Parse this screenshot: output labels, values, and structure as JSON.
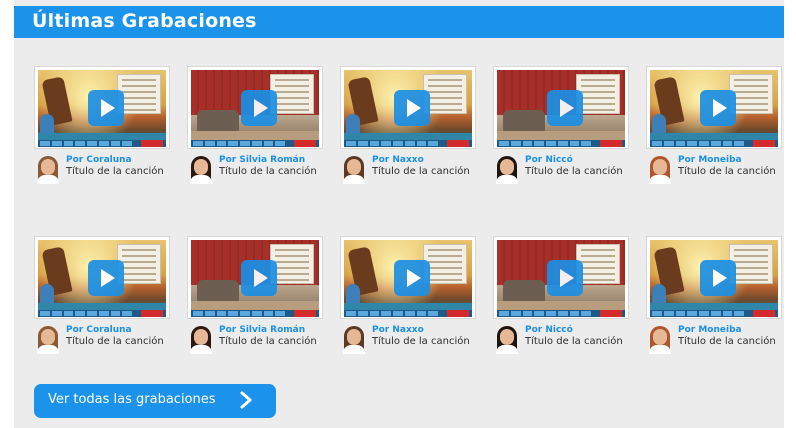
{
  "header": {
    "title": "Últimas Grabaciones"
  },
  "recordings": [
    {
      "author": "Por Coraluna",
      "song": "Título de la canción",
      "scene": "beach",
      "hair": "#8a5a34"
    },
    {
      "author": "Por Silvia Román",
      "song": "Título de la canción",
      "scene": "room",
      "hair": "#2a1a12"
    },
    {
      "author": "Por Naxxo",
      "song": "Título de la canción",
      "scene": "beach",
      "hair": "#5a3a22"
    },
    {
      "author": "Por Niccó",
      "song": "Título de la canción",
      "scene": "room",
      "hair": "#1d1410"
    },
    {
      "author": "Por Moneiba",
      "song": "Título de la canción",
      "scene": "beach",
      "hair": "#b0562e"
    },
    {
      "author": "Por Coraluna",
      "song": "Título de la canción",
      "scene": "beach",
      "hair": "#8a5a34"
    },
    {
      "author": "Por Silvia Román",
      "song": "Título de la canción",
      "scene": "room",
      "hair": "#2a1a12"
    },
    {
      "author": "Por Naxxo",
      "song": "Título de la canción",
      "scene": "beach",
      "hair": "#5a3a22"
    },
    {
      "author": "Por Niccó",
      "song": "Título de la canción",
      "scene": "room",
      "hair": "#1d1410"
    },
    {
      "author": "Por Moneiba",
      "song": "Título de la canción",
      "scene": "beach",
      "hair": "#b0562e"
    }
  ],
  "footer": {
    "view_all_label": "Ver todas las grabaciones",
    "arrow_icon": "chevron-right-icon"
  },
  "colors": {
    "accent": "#1b93ea",
    "panel": "#ececec",
    "author_text": "#1b8fe4"
  }
}
